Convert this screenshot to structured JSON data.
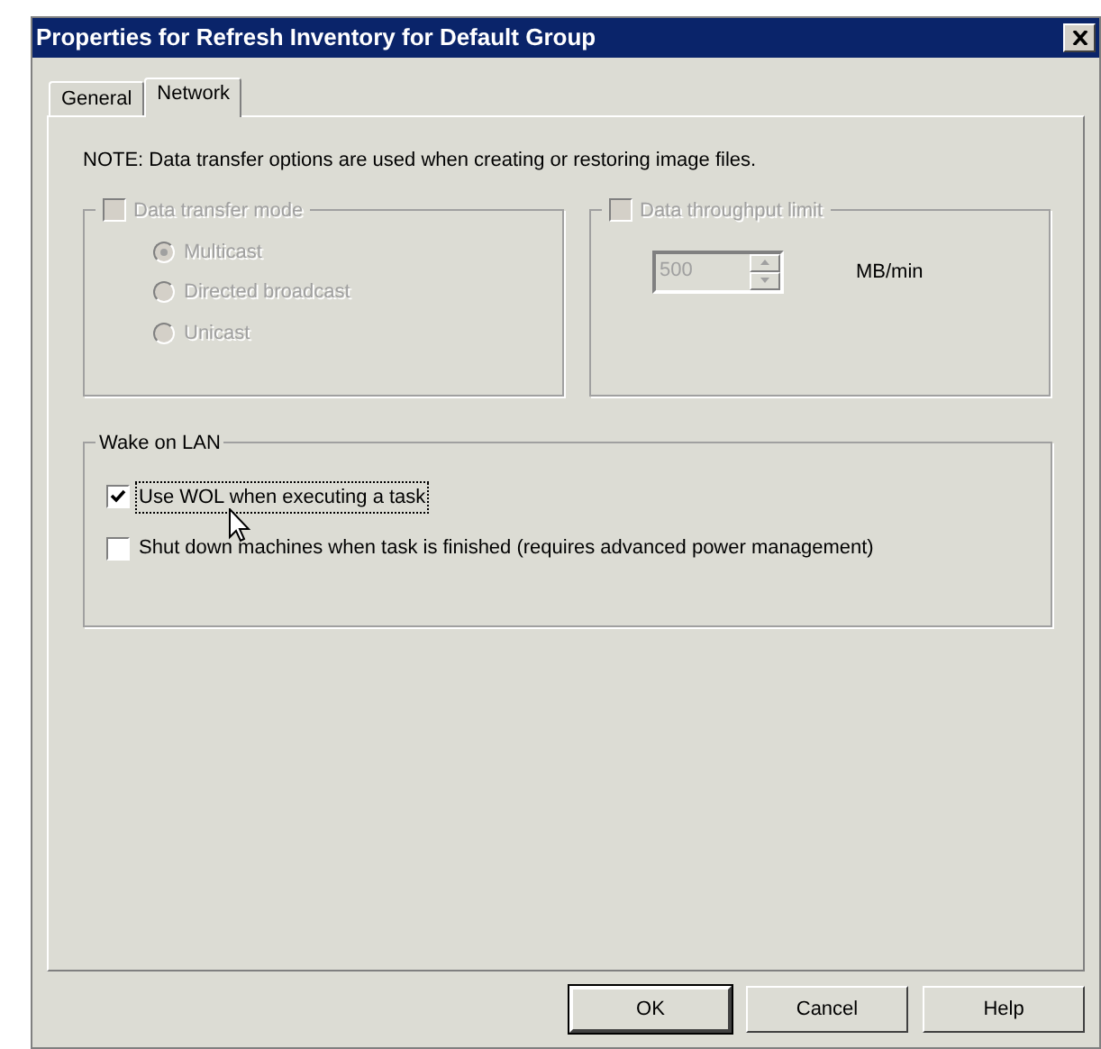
{
  "window": {
    "title": "Properties for Refresh Inventory for Default Group"
  },
  "tabs": [
    {
      "label": "General",
      "selected": false
    },
    {
      "label": "Network",
      "selected": true
    }
  ],
  "note": "NOTE: Data transfer options are used when creating or restoring image files.",
  "transfer_mode": {
    "label": "Data transfer mode",
    "checked": false,
    "disabled": true,
    "options": [
      {
        "label": "Multicast",
        "selected": true
      },
      {
        "label": "Directed broadcast",
        "selected": false
      },
      {
        "label": "Unicast",
        "selected": false
      }
    ]
  },
  "throughput_limit": {
    "label": "Data throughput limit",
    "checked": false,
    "disabled": true,
    "value": "500",
    "unit": "MB/min"
  },
  "wake_on_lan": {
    "title": "Wake on LAN",
    "options": [
      {
        "label": "Use WOL when executing a task",
        "checked": true,
        "focused": true
      },
      {
        "label": "Shut down machines when task is finished (requires advanced power management)",
        "checked": false,
        "focused": false
      }
    ]
  },
  "buttons": [
    {
      "label": "OK",
      "default": true
    },
    {
      "label": "Cancel",
      "default": false
    },
    {
      "label": "Help",
      "default": false
    }
  ]
}
